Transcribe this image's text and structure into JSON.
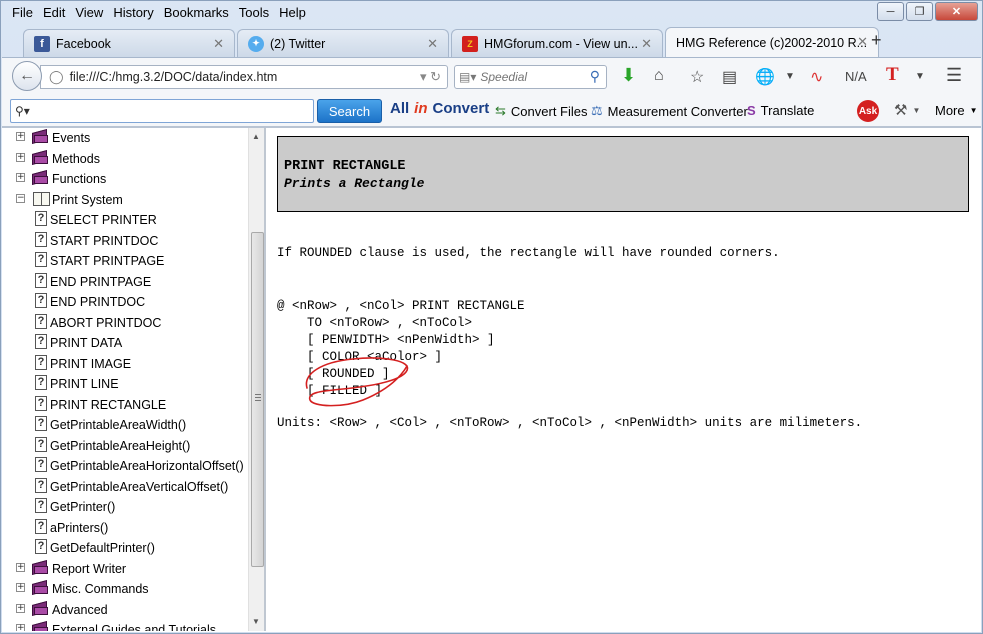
{
  "menubar": {
    "items": [
      {
        "label": "File"
      },
      {
        "label": "Edit"
      },
      {
        "label": "View"
      },
      {
        "label": "History"
      },
      {
        "label": "Bookmarks"
      },
      {
        "label": "Tools"
      },
      {
        "label": "Help"
      }
    ]
  },
  "tabs": [
    {
      "title": "Facebook",
      "icon": "facebook-icon"
    },
    {
      "title": "(2) Twitter",
      "icon": "twitter-icon"
    },
    {
      "title": "HMGforum.com - View un...",
      "icon": "hmg-icon"
    },
    {
      "title": "HMG Reference (c)2002-2010 R...",
      "icon": "none",
      "active": true
    }
  ],
  "navbar": {
    "url": "file:///C:/hmg.3.2/DOC/data/index.htm",
    "speedial_placeholder": "Speedial",
    "na_label": "N/A"
  },
  "searchbar": {
    "search_button": "Search",
    "allin_brand_a": "All",
    "allin_brand_b": "in",
    "allin_brand_c": "Convert",
    "convert_files": "Convert Files",
    "measurement_converter": "Measurement Converter",
    "translate": "Translate",
    "more": "More"
  },
  "tree": {
    "folders_top": [
      {
        "label": "Events"
      },
      {
        "label": "Methods"
      },
      {
        "label": "Functions"
      }
    ],
    "open_folder": {
      "label": "Print System"
    },
    "pages": [
      {
        "label": "SELECT PRINTER"
      },
      {
        "label": "START PRINTDOC"
      },
      {
        "label": "START PRINTPAGE"
      },
      {
        "label": "END PRINTPAGE"
      },
      {
        "label": "END PRINTDOC"
      },
      {
        "label": "ABORT PRINTDOC"
      },
      {
        "label": "PRINT DATA"
      },
      {
        "label": "PRINT IMAGE"
      },
      {
        "label": "PRINT LINE"
      },
      {
        "label": "PRINT RECTANGLE"
      },
      {
        "label": "GetPrintableAreaWidth()"
      },
      {
        "label": "GetPrintableAreaHeight()"
      },
      {
        "label": "GetPrintableAreaHorizontalOffset()"
      },
      {
        "label": "GetPrintableAreaVerticalOffset()"
      },
      {
        "label": "GetPrinter()"
      },
      {
        "label": "aPrinters()"
      },
      {
        "label": "GetDefaultPrinter()"
      }
    ],
    "folders_bottom": [
      {
        "label": "Report Writer"
      },
      {
        "label": "Misc. Commands"
      },
      {
        "label": "Advanced"
      },
      {
        "label": "External Guides and Tutorials"
      }
    ]
  },
  "doc": {
    "title": "PRINT RECTANGLE",
    "subtitle": "Prints a Rectangle",
    "intro": "If ROUNDED clause is used, the rectangle will have rounded corners.",
    "syntax": [
      "@ <nRow> , <nCol> PRINT RECTANGLE",
      "    TO <nToRow> , <nToCol>",
      "    [ PENWIDTH> <nPenWidth> ]",
      "    [ COLOR <aColor> ]",
      "    [ ROUNDED ]",
      "    [ FILLED ]"
    ],
    "units": "Units: <Row> , <Col> , <nToRow> , <nToCol> , <nPenWidth> units are milimeters."
  },
  "colors": {
    "annotation": "#d42020",
    "book": "#7a2a78",
    "search_button": "#1d73c8"
  }
}
